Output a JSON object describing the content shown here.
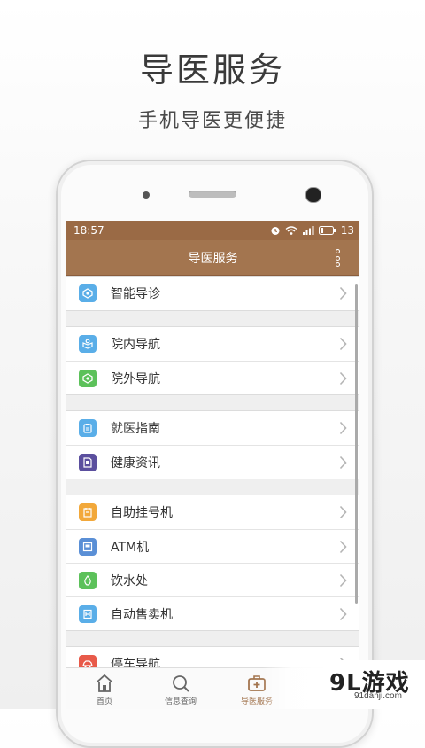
{
  "promo": {
    "title": "导医服务",
    "subtitle": "手机导医更便捷"
  },
  "status_bar": {
    "time": "18:57",
    "battery": "13",
    "icons": [
      "alarm-icon",
      "wifi-icon",
      "signal-icon",
      "battery-icon"
    ]
  },
  "navbar": {
    "title": "导医服务",
    "menu_icon": "more-vertical-icon"
  },
  "menu_groups": [
    {
      "items": [
        {
          "label": "智能导诊",
          "icon": "smart-triage-icon",
          "color": "#5aaee8"
        }
      ]
    },
    {
      "items": [
        {
          "label": "院内导航",
          "icon": "indoor-map-icon",
          "color": "#5aaee8"
        },
        {
          "label": "院外导航",
          "icon": "outdoor-nav-icon",
          "color": "#5cc15a"
        }
      ]
    },
    {
      "items": [
        {
          "label": "就医指南",
          "icon": "clipboard-icon",
          "color": "#5aaee8"
        },
        {
          "label": "健康资讯",
          "icon": "document-icon",
          "color": "#5b4f9e"
        }
      ]
    },
    {
      "items": [
        {
          "label": "自助挂号机",
          "icon": "kiosk-icon",
          "color": "#f2a83a"
        },
        {
          "label": "ATM机",
          "icon": "atm-icon",
          "color": "#5a8fd6"
        },
        {
          "label": "饮水处",
          "icon": "water-drop-icon",
          "color": "#5cc15a"
        },
        {
          "label": "自动售卖机",
          "icon": "vending-icon",
          "color": "#5aaee8"
        }
      ]
    },
    {
      "items": [
        {
          "label": "停车导航",
          "icon": "car-icon",
          "color": "#e85a4a"
        }
      ]
    }
  ],
  "tab_bar": {
    "tabs": [
      {
        "label": "首页",
        "icon": "home-icon",
        "active": false
      },
      {
        "label": "信息查询",
        "icon": "search-icon",
        "active": false
      },
      {
        "label": "导医服务",
        "icon": "medical-kit-icon",
        "active": true
      }
    ]
  },
  "watermark": {
    "brand": "9L游戏",
    "url": "91danji.com"
  },
  "colors": {
    "header_brown": "#a3754f",
    "status_brown": "#9a6a45",
    "active_tab": "#a3754f"
  }
}
